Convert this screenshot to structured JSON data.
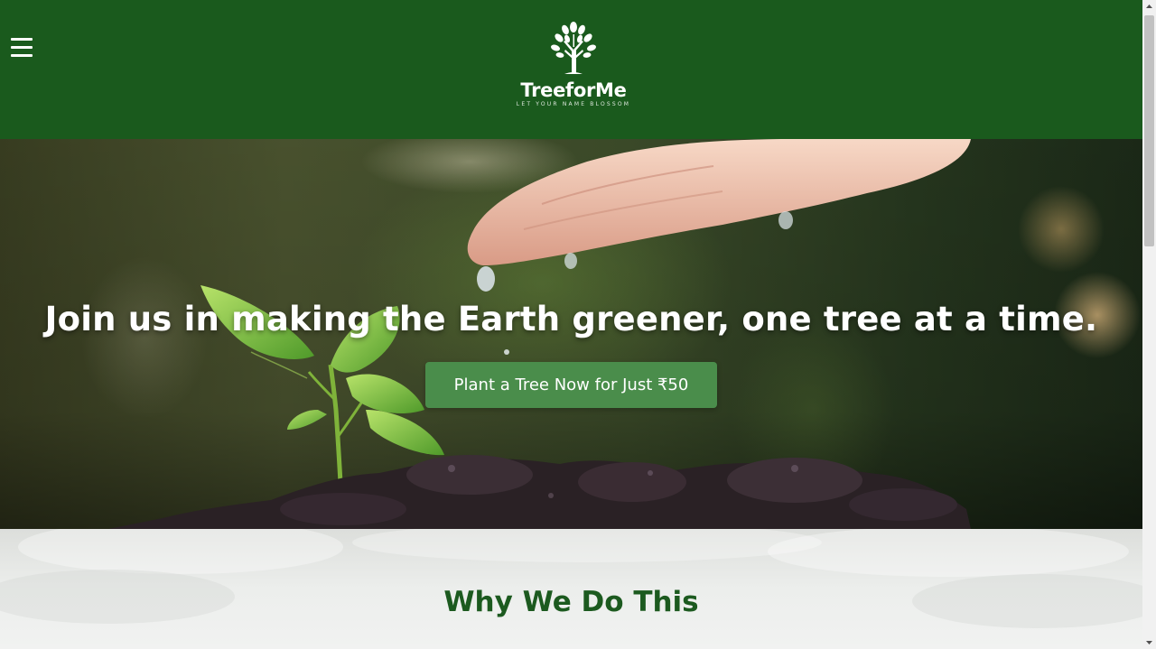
{
  "header": {
    "menu_icon": "hamburger-menu-icon",
    "logo": {
      "icon": "tree-icon",
      "name": "TreeforMe",
      "tagline": "LET YOUR NAME BLOSSOM"
    },
    "background_color": "#1a5a1d"
  },
  "hero": {
    "title": "Join us in making the Earth greener, one tree at a time.",
    "cta_label": "Plant a Tree Now for Just ₹50",
    "cta_color": "#4a8d4b",
    "image": "hand watering seedling in soil"
  },
  "why_section": {
    "title": "Why We Do This",
    "title_color": "#1c5a1f"
  },
  "scrollbar": {
    "up_icon": "scroll-up-arrow-icon",
    "down_icon": "scroll-down-arrow-icon"
  }
}
